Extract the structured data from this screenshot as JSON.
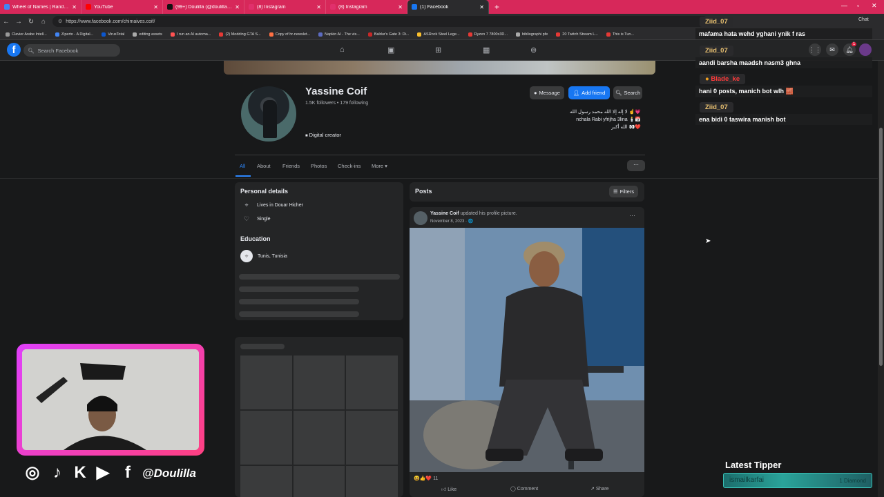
{
  "browser": {
    "tabs": [
      {
        "label": "Wheel of Names | Random name",
        "color": "#4285f4"
      },
      {
        "label": "YouTube",
        "color": "#ff0000"
      },
      {
        "label": "(99+) Doulilla (@doulilla_) | TikTok",
        "color": "#111111"
      },
      {
        "label": "(8) Instagram",
        "color": "#e1306c"
      },
      {
        "label": "(8) Instagram",
        "color": "#e1306c"
      },
      {
        "label": "(1) Facebook",
        "color": "#1877f2"
      }
    ],
    "new_tab": "+",
    "url": "https://www.facebook.com/chimaives.coif/",
    "bookmarks": [
      "Clavier Arabe Intell...",
      "Ziperto - A Digital...",
      "VirusTotal",
      "editing assets",
      "I run an AI automa...",
      "(2) Modding GTA S...",
      "Copy of hr-newslet...",
      "Napkin AI - The vis...",
      "Baldur's Gate 3: Di...",
      "ASRock Steel Lege...",
      "Ryzen 7 7800x3D...",
      "bibliographi pfe",
      "20 Twitch Stream L...",
      "This is Tun..."
    ],
    "chat_label": "Chat"
  },
  "fb": {
    "search_placeholder": "Search Facebook",
    "notification_count": "1"
  },
  "profile": {
    "name": "Yassine Coif",
    "stats": "1.5K followers • 179 following",
    "category": "Digital creator",
    "buttons": {
      "message": "Message",
      "add_friend": "Add friend",
      "search": "Search"
    },
    "bio_lines": [
      "لا إله إلا الله محمد رسول الله ☝️💗",
      "nchala Rabi yfrijha 3lina 🕯️📅",
      "الله أكبر 👀❤️"
    ],
    "tabs": [
      "All",
      "About",
      "Friends",
      "Photos",
      "Check-ins",
      "More ▾"
    ],
    "more_dots": "···"
  },
  "details": {
    "title": "Personal details",
    "lives_in": "Lives in Douar Hicher",
    "relationship": "Single",
    "education_title": "Education",
    "education": "Tunis, Tunisia"
  },
  "posts": {
    "title": "Posts",
    "filters": "Filters",
    "author": "Yassine Coif",
    "action": "updated his profile picture.",
    "date": "November 8, 2023 · 🌐",
    "post_menu": "···",
    "reaction_count": "11",
    "like": "Like",
    "comment": "Comment",
    "share": "Share"
  },
  "chat": [
    {
      "user": "Ziid_07",
      "msg": "mafama hata wehd yghani ynik f ras",
      "color": "#e8c070"
    },
    {
      "user": "Ziid_07",
      "msg": "aandi barsha maadsh nasm3 ghna",
      "color": "#e8c070"
    },
    {
      "user": "Blade_ke",
      "msg": "hani 0 posts, manich bot wlh 🧱",
      "color": "#ff3b3b"
    },
    {
      "user": "Ziid_07",
      "msg": "ena bidi 0 taswira manish bot",
      "color": "#e8c070"
    }
  ],
  "stream": {
    "handle": "@Doulilla",
    "latest_tipper_title": "Latest Tipper",
    "tipper_name": "ismailkarfai",
    "tipper_amount": "1 Diamond"
  }
}
